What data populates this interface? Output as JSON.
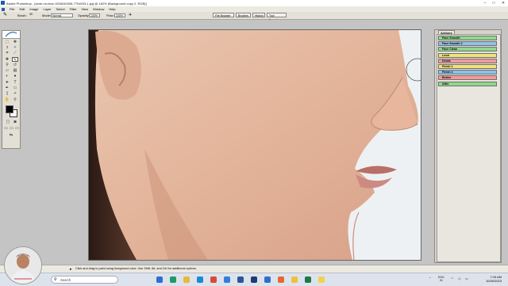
{
  "window": {
    "title": "Adobe Photoshop - [acne-on-face-1534040006-770x533-1.jpg @ 162% (Background copy 2, RGB)]",
    "controls": [
      "–",
      "□",
      "✕"
    ]
  },
  "menu": [
    "File",
    "Edit",
    "Image",
    "Layer",
    "Select",
    "Filter",
    "View",
    "Window",
    "Help"
  ],
  "options": {
    "brush_label": "Brush:",
    "brush_size": "30",
    "mode_label": "Mode:",
    "mode_value": "Normal",
    "opacity_label": "Opacity:",
    "opacity_value": "100%",
    "flow_label": "Flow:",
    "flow_value": "100%",
    "workspace_tabs": [
      "File Browser",
      "Brushes",
      "History",
      "Tool Presets"
    ]
  },
  "actions_panel": {
    "tab": "Actions",
    "items": [
      {
        "label": "Face Smooth",
        "color": "#8fd88a"
      },
      {
        "label": "Face Smooth 2",
        "color": "#8fc0e8"
      },
      {
        "label": "Face Clean",
        "color": "#8fd88a"
      },
      {
        "label": "Level",
        "color": "#f0e27a"
      },
      {
        "label": "Delete",
        "color": "#f39a9a"
      },
      {
        "label": "Finish 1",
        "color": "#f0e27a"
      },
      {
        "label": "Finish 2",
        "color": "#8fc0e8"
      },
      {
        "label": "Before",
        "color": "#f39a9a"
      },
      {
        "label": "After",
        "color": "#8fd88a"
      }
    ]
  },
  "status": {
    "message": "Click and drag to paint using foreground color.  Use Shift, Alt, and Ctrl for additional options."
  },
  "taskbar": {
    "search_placeholder": "Search",
    "language": "ENG",
    "region": "IN",
    "time": "7:43 AM",
    "date": "10/30/2023",
    "apps": [
      {
        "name": "start-icon",
        "color": "#2a6fd6"
      },
      {
        "name": "widgets-icon",
        "color": "#1d9b6c"
      },
      {
        "name": "file-explorer-icon",
        "color": "#e8b93c"
      },
      {
        "name": "edge-icon",
        "color": "#1a8ad4"
      },
      {
        "name": "chrome-icon",
        "color": "#d94a3a"
      },
      {
        "name": "photos-icon",
        "color": "#2d7fe0"
      },
      {
        "name": "word-icon",
        "color": "#2b579a"
      },
      {
        "name": "photoshop-icon",
        "color": "#1f3b73"
      },
      {
        "name": "mail-icon",
        "color": "#2f6fd0"
      },
      {
        "name": "media-player-icon",
        "color": "#e36a2c"
      },
      {
        "name": "folder-icon",
        "color": "#f0c040"
      },
      {
        "name": "excel-icon",
        "color": "#1d7a45"
      },
      {
        "name": "notes-icon",
        "color": "#f2d24b"
      }
    ]
  }
}
